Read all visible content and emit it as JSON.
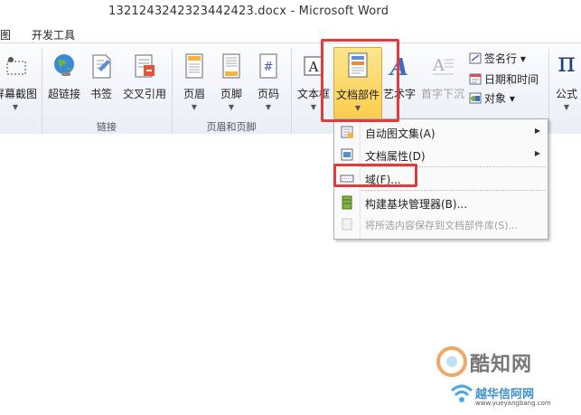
{
  "window": {
    "title": "1321243242323442423.docx - Microsoft Word"
  },
  "tabs": [
    {
      "label": "图"
    },
    {
      "label": "开发工具"
    }
  ],
  "ribbon": {
    "buttons": [
      {
        "label": "屏幕截图",
        "icon": "screenshot-icon"
      },
      {
        "label": "超链接",
        "icon": "globe-link-icon"
      },
      {
        "label": "书签",
        "icon": "bookmark-icon"
      },
      {
        "label": "交叉引用",
        "icon": "cross-reference-icon"
      },
      {
        "label": "页眉",
        "icon": "header-icon"
      },
      {
        "label": "页脚",
        "icon": "footer-icon"
      },
      {
        "label": "页码",
        "icon": "page-number-icon"
      },
      {
        "label": "文本框",
        "icon": "text-box-icon"
      },
      {
        "label": "文档部件",
        "icon": "quick-parts-icon"
      },
      {
        "label": "艺术字",
        "icon": "wordart-icon"
      },
      {
        "label": "首字下沉",
        "icon": "drop-cap-icon"
      },
      {
        "label": "公式",
        "icon": "pi-icon",
        "glyph": "π"
      }
    ],
    "small_buttons": [
      {
        "label": "签名行 ▾",
        "icon": "signature-line-icon"
      },
      {
        "label": "日期和时间",
        "icon": "date-time-icon"
      },
      {
        "label": "对象 ▾",
        "icon": "object-icon"
      }
    ],
    "groups": [
      {
        "label": "链接"
      },
      {
        "label": "页眉和页脚"
      }
    ],
    "wordart_glyph": "A",
    "textbox_glyph": "A",
    "page_number_glyph": "#"
  },
  "menu": {
    "items": [
      {
        "label": "自动图文集(A)",
        "icon": "autotext-icon",
        "submenu": true,
        "disabled": false
      },
      {
        "label": "文档属性(D)",
        "icon": "document-property-icon",
        "submenu": true,
        "disabled": false
      },
      {
        "label": "域(F)...",
        "icon": "field-icon",
        "submenu": false,
        "disabled": false
      },
      {
        "label": "构建基块管理器(B)...",
        "icon": "building-blocks-icon",
        "submenu": false,
        "disabled": false
      },
      {
        "label": "将所选内容保存到文档部件库(S)...",
        "icon": "save-selection-icon",
        "submenu": false,
        "disabled": true
      }
    ]
  },
  "watermark": {
    "text1": "酷知网",
    "text2": "越华信阿网",
    "url": "www.yueyangbang.com"
  },
  "colors": {
    "highlight": "#e23b3b",
    "active_button": "#fbd55b",
    "disabled_text": "#a0a0a0"
  }
}
